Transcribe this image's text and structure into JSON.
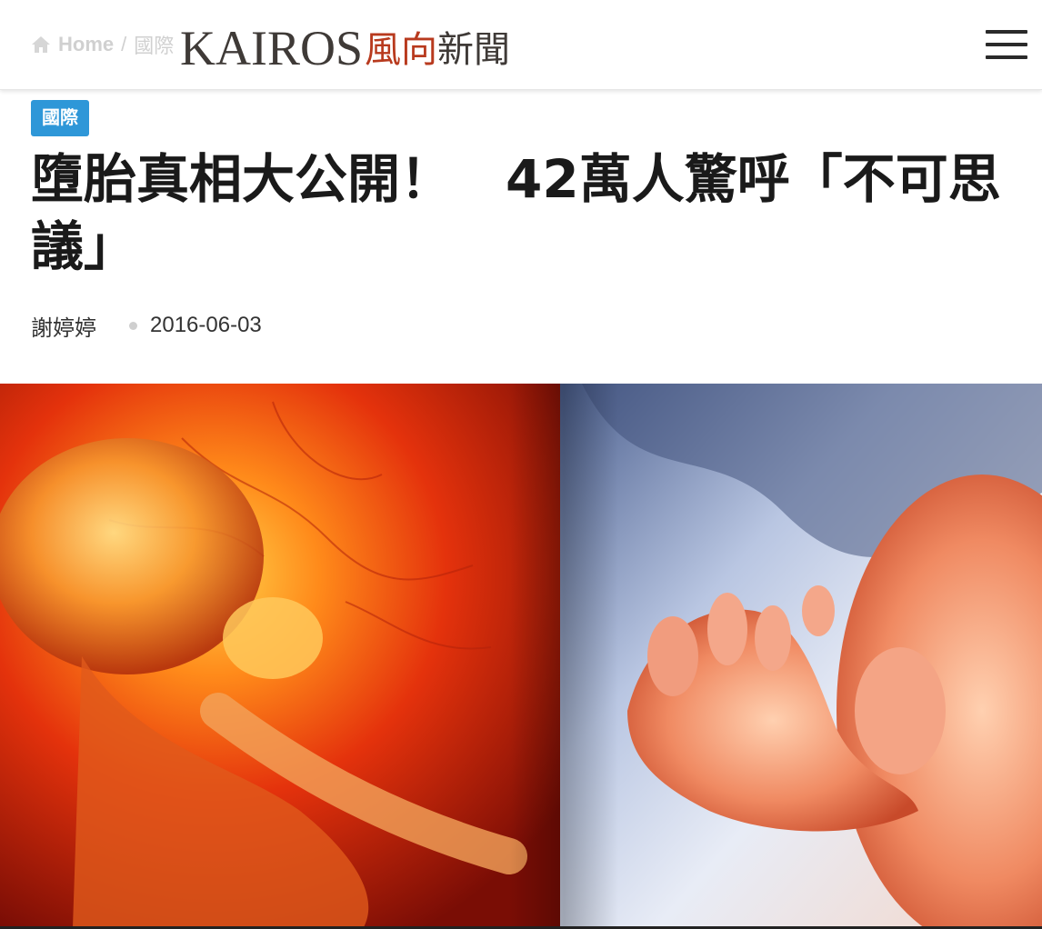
{
  "breadcrumb": {
    "home_label": "Home",
    "separator": "/",
    "category": "國際"
  },
  "logo": {
    "latin": "KAIROS",
    "cn_red": "風向",
    "cn_dark": "新聞"
  },
  "article": {
    "category": "國際",
    "title": "墮胎真相大公開！　42萬人驚呼「不可思議」",
    "author": "謝婷婷",
    "date": "2016-06-03"
  },
  "hero_image": {
    "alt_subject": "fetus-photo-composite"
  },
  "colors": {
    "badge": "#2e97d8",
    "logo_red": "#b83a1e",
    "logo_dark": "#3f3a37",
    "title_text": "#1a1a1a"
  },
  "icons": {
    "home": "home-icon",
    "menu": "hamburger-menu-icon"
  }
}
